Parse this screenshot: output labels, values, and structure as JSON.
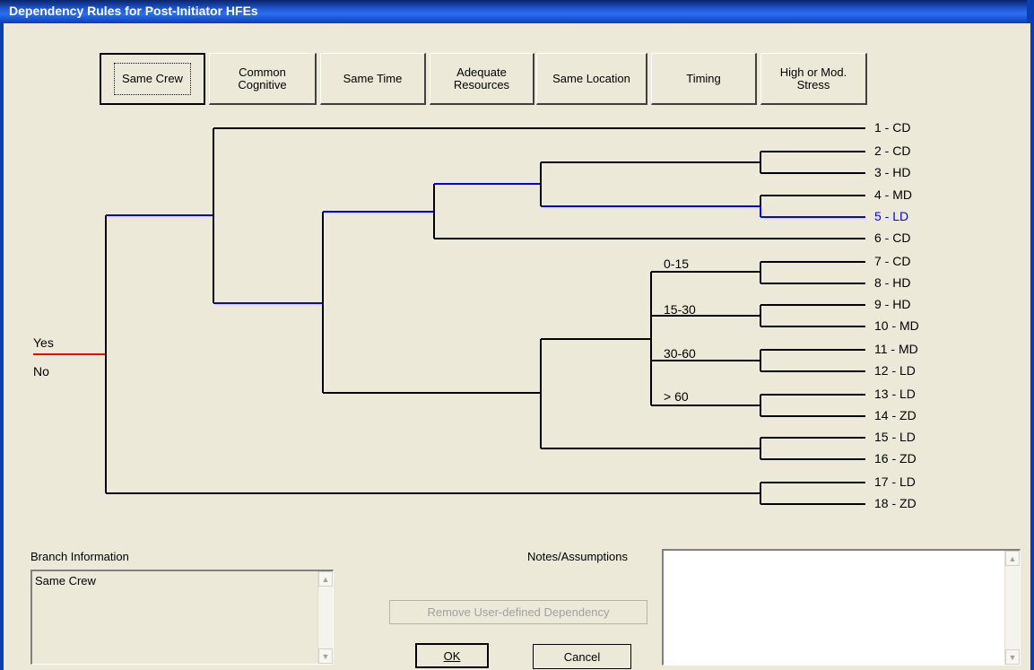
{
  "window": {
    "title": "Dependency Rules for Post-Initiator HFEs"
  },
  "tabs": [
    {
      "label": "Same Crew"
    },
    {
      "label": "Common\nCognitive"
    },
    {
      "label": "Same Time"
    },
    {
      "label": "Adequate\nResources"
    },
    {
      "label": "Same Location"
    },
    {
      "label": "Timing"
    },
    {
      "label": "High or Mod.\nStress"
    }
  ],
  "tree": {
    "root": {
      "yes": "Yes",
      "no": "No"
    },
    "leaves": [
      "1 - CD",
      "2 - CD",
      "3 - HD",
      "4 - MD",
      "5 - LD",
      "6 - CD",
      "7 - CD",
      "8 - HD",
      "9 - HD",
      "10 - MD",
      "11 - MD",
      "12 - LD",
      "13 - LD",
      "14 - ZD",
      "15 - LD",
      "16 - ZD",
      "17 - LD",
      "18 - ZD"
    ],
    "timing_labels": [
      "0-15",
      "15-30",
      "30-60",
      "> 60"
    ],
    "selected_leaf": "5 - LD",
    "colors": {
      "line": "#000000",
      "path": "#0000ff",
      "root": "#ff0000"
    }
  },
  "branch_info": {
    "label": "Branch Information",
    "value": "Same Crew"
  },
  "notes": {
    "label": "Notes/Assumptions",
    "value": ""
  },
  "buttons": {
    "remove": "Remove User-defined Dependency",
    "ok": "OK",
    "cancel": "Cancel"
  }
}
